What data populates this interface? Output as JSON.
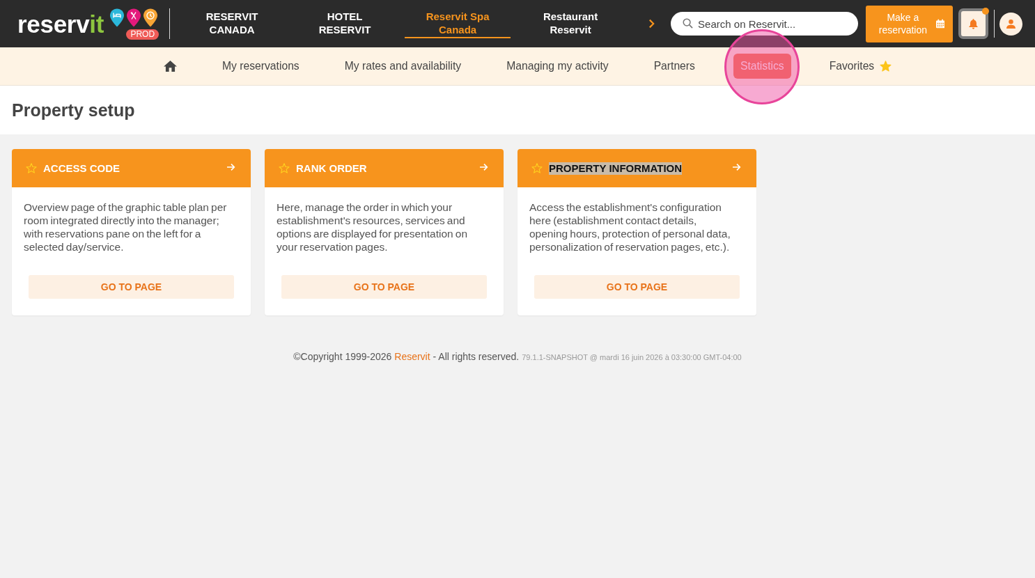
{
  "header": {
    "logo": {
      "wordmark": [
        "reserv",
        "it"
      ],
      "badge": "PROD"
    },
    "tabs": [
      {
        "label": "RESERVIT CANADA",
        "selected": false
      },
      {
        "label": "HOTEL RESERVIT",
        "selected": false
      },
      {
        "label": "Reservit Spa Canada",
        "selected": true
      },
      {
        "label": "Restaurant Reservit",
        "selected": false
      }
    ],
    "search": {
      "placeholder": "Search on Reservit..."
    },
    "reserve_button": {
      "label": "Make a reservation"
    },
    "notifications": {
      "unread": true
    }
  },
  "nav": {
    "items": [
      {
        "kind": "home",
        "selected": false,
        "highlighted": false
      },
      {
        "kind": "link",
        "label": "My reservations",
        "selected": false,
        "highlighted": false
      },
      {
        "kind": "link",
        "label": "My rates and availability",
        "selected": false,
        "highlighted": false
      },
      {
        "kind": "link",
        "label": "Managing my activity",
        "selected": false,
        "highlighted": false
      },
      {
        "kind": "link",
        "label": "Partners",
        "selected": false,
        "highlighted": false
      },
      {
        "kind": "link",
        "label": "Statistics",
        "selected": true,
        "highlighted": true
      },
      {
        "kind": "favorites",
        "label": "Favorites",
        "selected": false,
        "highlighted": false
      }
    ]
  },
  "page": {
    "title": "Property setup"
  },
  "cards": [
    {
      "title": "ACCESS CODE",
      "favorite": false,
      "title_selected": false,
      "description": "Overview page of the graphic table plan per room integrated directly into the manager; with reservations pane on the left for a selected day/service.",
      "button": "GO TO PAGE"
    },
    {
      "title": "RANK ORDER",
      "favorite": false,
      "title_selected": false,
      "description": "Here, manage the order in which your establishment's resources, services and options are displayed for presentation on your reservation pages.",
      "button": "GO TO PAGE"
    },
    {
      "title": "PROPERTY INFORMATION",
      "favorite": false,
      "title_selected": true,
      "description": "Access the establishment's configuration here (establishment contact details, opening hours, protection of personal data, personalization of reservation pages, etc.).",
      "button": "GO TO PAGE"
    }
  ],
  "footer": {
    "copyright_start": "©Copyright 1999-2026",
    "link": "Reservit",
    "copyright_end": "- All rights reserved.",
    "build": "79.1.1-SNAPSHOT @ mardi 16 juin 2026 à 03:30:00 GMT-04:00"
  }
}
